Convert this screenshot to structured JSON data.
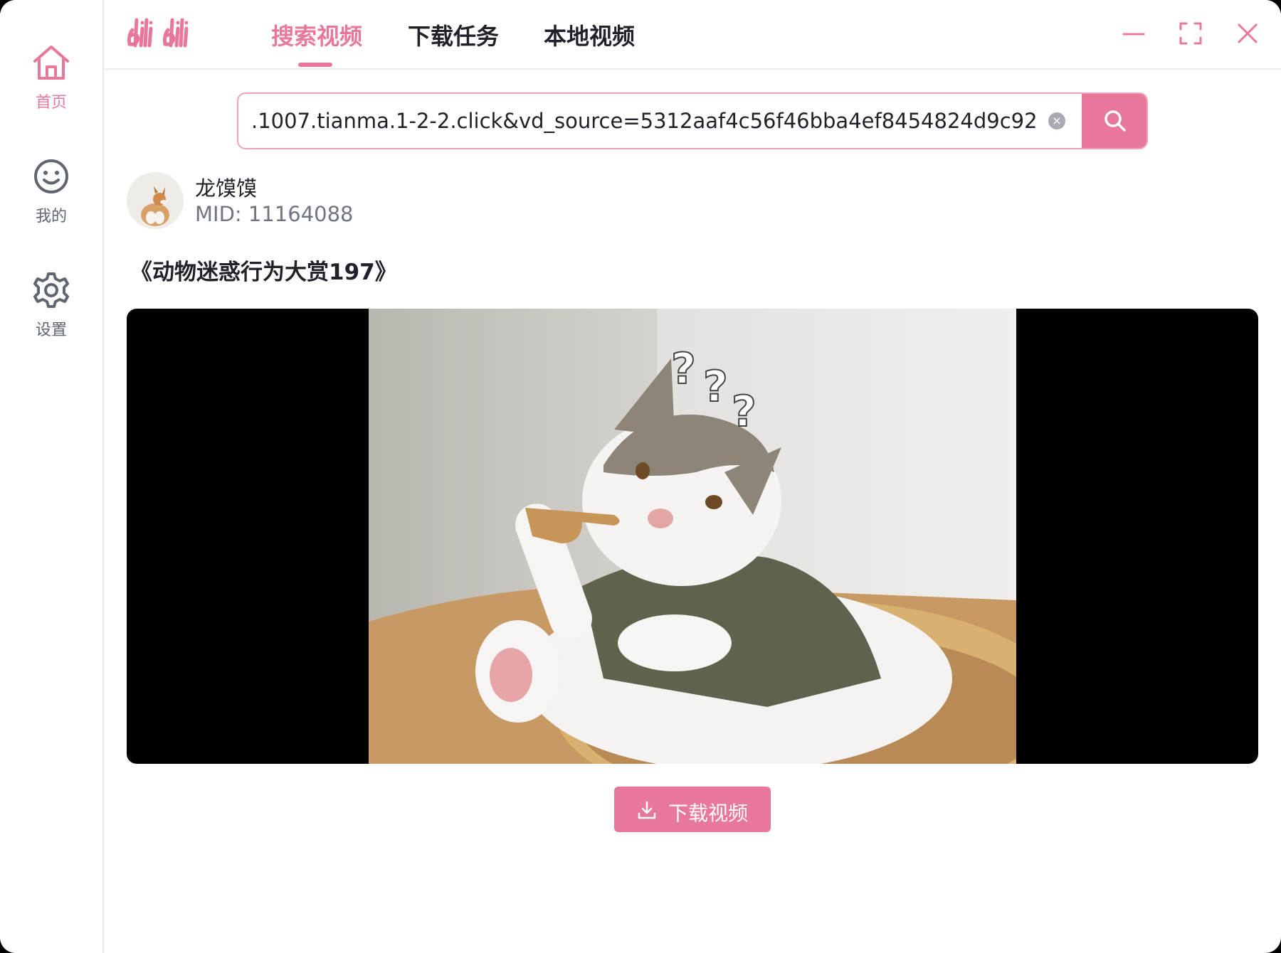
{
  "sidebar": {
    "items": [
      {
        "label": "首页",
        "icon": "home-icon",
        "active": true
      },
      {
        "label": "我的",
        "icon": "smile-icon",
        "active": false
      },
      {
        "label": "设置",
        "icon": "gear-icon",
        "active": false
      }
    ]
  },
  "header": {
    "logo_text": "bilibili",
    "tabs": [
      {
        "label": "搜索视频",
        "active": true
      },
      {
        "label": "下载任务",
        "active": false
      },
      {
        "label": "本地视频",
        "active": false
      }
    ],
    "window_controls": [
      "minimize-icon",
      "fullscreen-icon",
      "close-icon"
    ]
  },
  "search": {
    "value": ".1007.tianma.1-2-2.click&vd_source=5312aaf4c56f46bba4ef8454824d9c92",
    "button_icon": "search-icon"
  },
  "uploader": {
    "name": "龙馍馍",
    "mid": "MID: 11164088"
  },
  "video": {
    "title": "《动物迷惑行为大赏197》"
  },
  "download": {
    "label": "下载视频",
    "icon": "download-icon"
  },
  "colors": {
    "accent": "#e8789a",
    "text": "#1f2329",
    "muted": "#707580"
  }
}
